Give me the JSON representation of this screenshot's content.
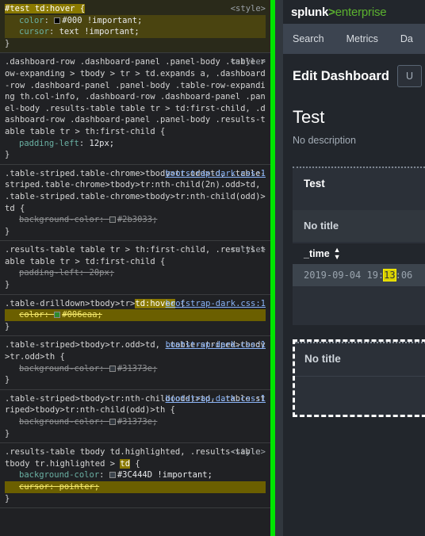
{
  "devtools": {
    "rules": [
      {
        "id": "rule-test-td-hover",
        "selector_pre": "",
        "selector_hl": "#test td:hover {",
        "origin": "<style>",
        "origin_is_link": false,
        "highlight_rule": true,
        "declarations": [
          {
            "prop": "color",
            "value": "#000 !important;",
            "swatch": "#000000",
            "overridden": false
          },
          {
            "prop": "cursor",
            "value": "text !important;",
            "swatch": null,
            "overridden": false
          }
        ]
      },
      {
        "id": "rule-dashboard-row-padding-12",
        "selector_pre": ".dashboard-row .dashboard-panel .panel-body .table-row-expanding > tbody > tr > td.expands a, .dashboard-row .dashboard-panel .panel-body .table-row-expanding th.col-info, .dashboard-row .dashboard-panel .panel-body .results-table table tr > td:first-child, .dashboard-row .dashboard-panel .panel-body .results-table table tr > th:first-child {",
        "selector_hl": "",
        "origin": "<style>",
        "origin_is_link": false,
        "highlight_rule": false,
        "declarations": [
          {
            "prop": "padding-left",
            "value": "12px;",
            "swatch": null,
            "overridden": false
          }
        ]
      },
      {
        "id": "rule-table-striped-chrome-odd",
        "selector_pre": ".table-striped.table-chrome>tbody>tr.odd>td, .table-striped.table-chrome>tbody>tr:nth-child(2n).odd>td, .table-striped.table-chrome>tbody>tr:nth-child(odd)>td {",
        "selector_hl": "",
        "origin": "bootstrap-dark.css:1",
        "origin_is_link": true,
        "highlight_rule": false,
        "declarations": [
          {
            "prop": "background-color",
            "value": "#2b3033;",
            "swatch": "#2b3033",
            "overridden": true
          }
        ]
      },
      {
        "id": "rule-results-table-first-child-20",
        "selector_pre": ".results-table table tr > th:first-child, .results-table table tr > td:first-child {",
        "selector_hl": "",
        "origin": "<style>",
        "origin_is_link": false,
        "highlight_rule": false,
        "declarations": [
          {
            "prop": "padding-left",
            "value": "20px;",
            "swatch": null,
            "overridden": true
          }
        ]
      },
      {
        "id": "rule-table-drilldown-td-hover",
        "selector_pre": ".table-drilldown>tbody>tr>",
        "selector_hl": "td:hover",
        "selector_post": " {",
        "origin": "bootstrap-dark.css:1",
        "origin_is_link": true,
        "highlight_rule": false,
        "declarations": [
          {
            "prop": "color",
            "value": "#006eaa;",
            "swatch": "#2e8b2e",
            "overridden": true,
            "yellow": true
          }
        ]
      },
      {
        "id": "rule-table-striped-odd",
        "selector_pre": ".table-striped>tbody>tr.odd>td, .table-striped>tbody>tr.odd>th {",
        "selector_hl": "",
        "origin": "bootstrap-dark.css:1",
        "origin_is_link": true,
        "highlight_rule": false,
        "declarations": [
          {
            "prop": "background-color",
            "value": "#31373e;",
            "swatch": "#31373e",
            "overridden": true
          }
        ]
      },
      {
        "id": "rule-table-striped-nth-odd",
        "selector_pre": ".table-striped>tbody>tr:nth-child(odd)>td, .table-striped>tbody>tr:nth-child(odd)>th {",
        "selector_hl": "",
        "origin": "bootstrap-dark.css:1",
        "origin_is_link": true,
        "highlight_rule": false,
        "declarations": [
          {
            "prop": "background-color",
            "value": "#31373e;",
            "swatch": "#31373e",
            "overridden": true
          }
        ]
      },
      {
        "id": "rule-results-table-highlighted",
        "selector_pre": ".results-table tbody td.highlighted, .results-table tbody tr.highlighted > ",
        "selector_hl": "td",
        "selector_post": " {",
        "origin": "<style>",
        "origin_is_link": false,
        "highlight_rule": false,
        "declarations": [
          {
            "prop": "background-color",
            "value": "#3C444D !important;",
            "swatch": "#3C444D",
            "overridden": false
          },
          {
            "prop": "cursor",
            "value": "pointer;",
            "swatch": null,
            "overridden": true,
            "yellow": true
          }
        ]
      }
    ]
  },
  "splunk": {
    "logo": {
      "name": "splunk",
      "gt": ">",
      "product": "enterprise"
    },
    "nav": [
      {
        "label": "Search"
      },
      {
        "label": "Metrics"
      },
      {
        "label": "Da"
      }
    ],
    "edit_bar": {
      "title": "Edit Dashboard",
      "button_label": "U"
    },
    "dashboard": {
      "title": "Test",
      "description": "No description"
    },
    "panel_1": {
      "title": "Test",
      "sub_title": "No title",
      "table": {
        "columns": [
          "_time"
        ],
        "sort_icon": "sort-updown-icon",
        "rows": [
          {
            "time_pre": "2019-09-04 19:",
            "time_sel": "13",
            "time_post": ":06"
          }
        ]
      }
    },
    "panel_2": {
      "title": "No title"
    }
  },
  "colors": {
    "divider_green": "#00e500",
    "splunk_green": "#5bb12f",
    "nav_bg": "#3c4450",
    "panel_bg": "#2b3038",
    "row_highlight": "#3C444D",
    "devtools_bg": "#202124"
  }
}
